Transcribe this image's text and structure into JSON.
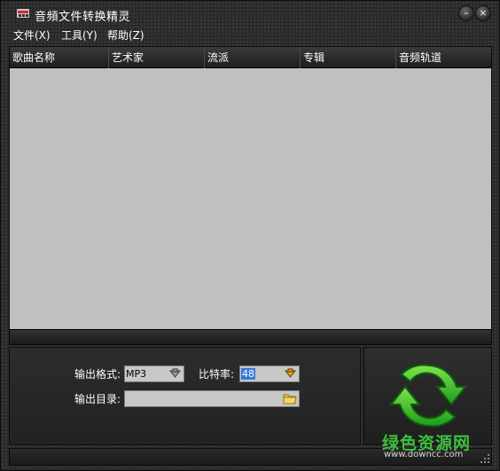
{
  "window": {
    "title": "音頻文件转换精灵",
    "minimize_glyph": "–",
    "close_glyph": "×"
  },
  "menu": [
    {
      "label": "文件(X)"
    },
    {
      "label": "工具(Y)"
    },
    {
      "label": "帮助(Z)"
    }
  ],
  "list": {
    "columns": [
      "歌曲名称",
      "艺术家",
      "流派",
      "专辑",
      "音频轨道"
    ],
    "rows": []
  },
  "settings": {
    "format_label": "输出格式:",
    "format_value": "MP3",
    "bitrate_label": "比特率:",
    "bitrate_value": "48",
    "dir_label": "输出目录:",
    "dir_value": ""
  },
  "watermark": {
    "text": "绿色资源网",
    "url": "www.downcc.com"
  },
  "icons": {
    "app": "app-logo-icon",
    "convert": "refresh-arrows-icon",
    "dropdown": "chevron-down-icon",
    "folder": "folder-icon"
  },
  "colors": {
    "accent_green": "#3ec03e",
    "list_bg": "#c0c0c0",
    "window_bg": "#2a2a2a"
  }
}
